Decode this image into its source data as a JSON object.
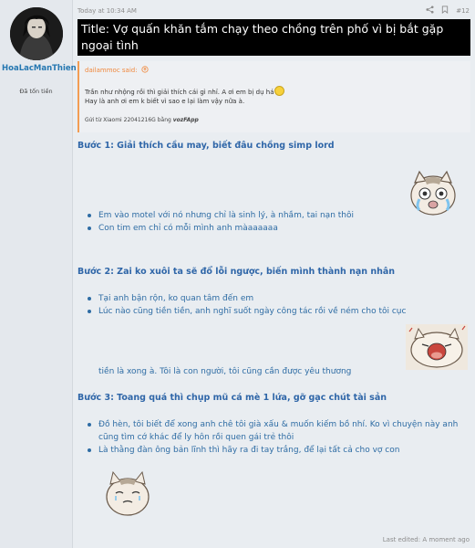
{
  "post": {
    "username": "HoaLacManThien",
    "user_title": "Đã tốn tiền",
    "date": "Today at 10:34 AM",
    "post_number": "#12",
    "icons": [
      "share-icon",
      "bookmark-icon",
      "flag-icon"
    ],
    "title": "Title: Vợ quấn khăn tắm chạy theo chồng trên phố vì bị bắt gặp ngoại tình",
    "last_edited": "Last edited: A moment ago"
  },
  "quote": {
    "author": "dailammoc said:",
    "line1": "Trần như nhộng rồi thì giải thích cái gì nhỉ. A ơi em bị dụ há",
    "line2": "Hay là anh ơi em k biết vì sao e lại làm vậy nữa à.",
    "signature_prefix": "Gửi từ Xiaomi 22041216G bằng",
    "signature_app": "vozFApp"
  },
  "sections": [
    {
      "heading": "Bước 1: Giải thích cầu may, biết đâu chồng simp lord",
      "items": [
        "Em vào motel với nó nhưng chỉ là sinh lý, à nhầm, tai nạn thôi",
        "Con tim em chỉ có mỗi mình anh màaaaaaa"
      ]
    },
    {
      "heading": "Bước 2: Zai ko xuôi ta sẽ đổ lỗi ngược, biến mình thành nạn nhân",
      "items": [
        "Tại anh bận rộn, ko quan tâm đến em",
        "Lúc nào cũng tiền tiền, anh nghĩ suốt ngày công tác rồi về ném cho tôi cục"
      ],
      "continuation": "tiền là xong à. Tôi là con người, tôi cũng cần được yêu thương"
    },
    {
      "heading": "Bước 3: Toang quá thì chụp mũ cá mè 1 lứa, gỡ gạc chút tài sản",
      "items": [
        "Đồ hèn, tôi biết để xong anh chê tôi già xấu & muốn kiếm bồ nhí. Ko vì chuyện này anh cũng tìm cớ khác để ly hôn rồi quen gái trẻ thôi",
        "Là thằng đàn ông bản lĩnh thì hãy ra đi tay trắng, để lại tất cả cho vợ con"
      ]
    }
  ]
}
